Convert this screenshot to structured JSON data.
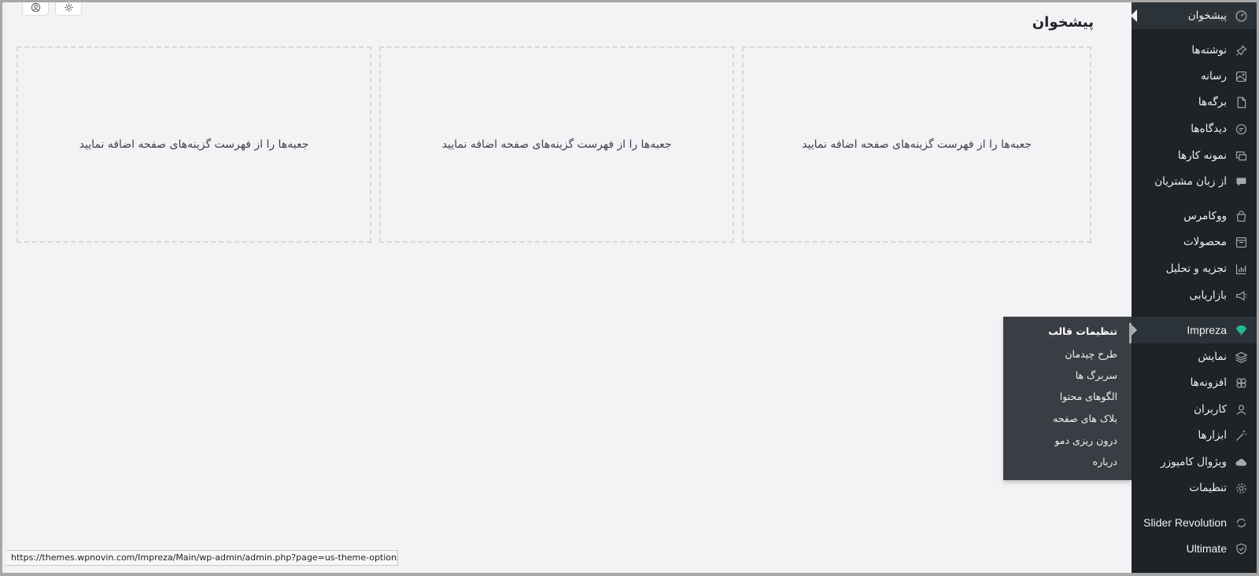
{
  "page": {
    "title": "پیشخوان"
  },
  "dashboard": {
    "empty_boxes": [
      "جعبه‌ها را از فهرست گزینه‌های صفحه اضافه نمایید",
      "جعبه‌ها را از فهرست گزینه‌های صفحه اضافه نمایید",
      "جعبه‌ها را از فهرست گزینه‌های صفحه اضافه نمایید"
    ]
  },
  "top_controls": {
    "icons": [
      "user-circle-icon",
      "gear-icon"
    ]
  },
  "sidebar": {
    "items": [
      {
        "label": "پیشخوان",
        "icon": "dashboard-icon",
        "current": true
      },
      {
        "label": "نوشته‌ها",
        "icon": "pin-icon"
      },
      {
        "label": "رسانه",
        "icon": "media-icon"
      },
      {
        "label": "برگه‌ها",
        "icon": "page-icon"
      },
      {
        "label": "دیدگاه‌ها",
        "icon": "comment-icon"
      },
      {
        "label": "نمونه کارها",
        "icon": "portfolio-icon"
      },
      {
        "label": "از زبان مشتریان",
        "icon": "testimonial-icon"
      },
      {
        "label": "ووکامرس",
        "icon": "shopping-bag-icon"
      },
      {
        "label": "محصولات",
        "icon": "archive-icon"
      },
      {
        "label": "تجزیه و تحلیل",
        "icon": "bar-chart-icon"
      },
      {
        "label": "بازاریابی",
        "icon": "megaphone-icon"
      },
      {
        "label": "Impreza",
        "icon": "diamond-icon",
        "hover": true,
        "accent": "#26c6a0"
      },
      {
        "label": "نمایش",
        "icon": "layers-icon"
      },
      {
        "label": "افزونه‌ها",
        "icon": "plugin-icon"
      },
      {
        "label": "کاربران",
        "icon": "user-icon"
      },
      {
        "label": "ابزارها",
        "icon": "wand-icon"
      },
      {
        "label": "ویژوال کامپوزر",
        "icon": "cloud-icon"
      },
      {
        "label": "تنظیمات",
        "icon": "settings-icon"
      },
      {
        "label": "Slider Revolution",
        "icon": "refresh-icon"
      },
      {
        "label": "Ultimate",
        "icon": "shield-icon"
      }
    ]
  },
  "impreza_submenu": [
    "تنظیمات قالب",
    "طرح چیدمان",
    "سربرگ ها",
    "الگوهای محتوا",
    "بلاک های صفحه",
    "درون ریزی دمو",
    "درباره"
  ],
  "status_bar": {
    "url": "https://themes.wpnovin.com/Impreza/Main/wp-admin/admin.php?page=us-theme-options"
  },
  "colors": {
    "sidebar_bg": "#1d2327",
    "submenu_bg": "#3a3d43",
    "content_bg": "#f3f3f5",
    "impreza_accent": "#26c6a0"
  }
}
